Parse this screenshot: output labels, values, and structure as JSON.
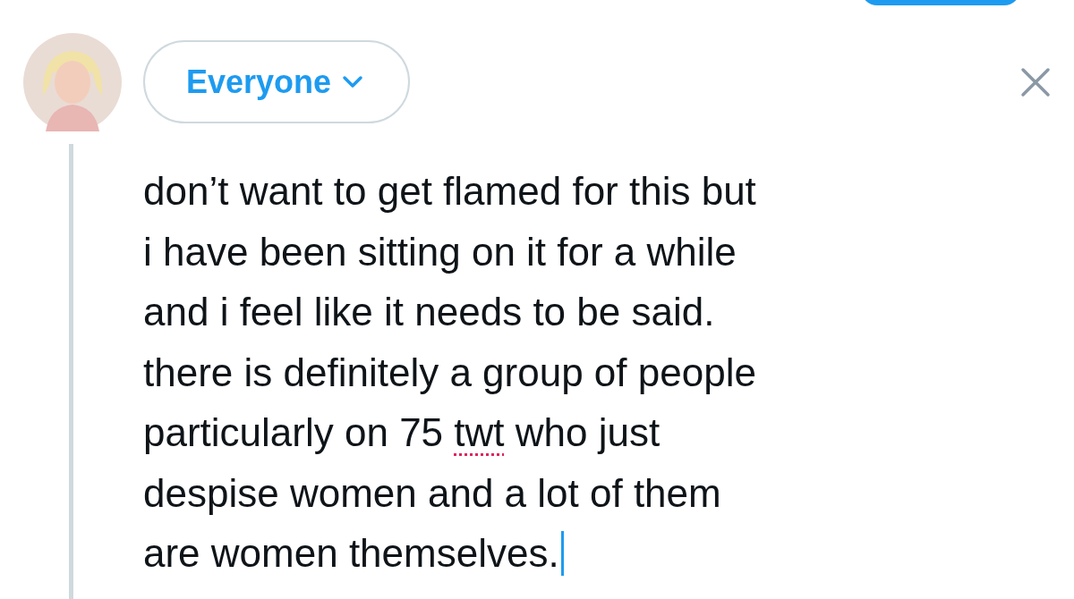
{
  "audience": {
    "label": "Everyone"
  },
  "composer": {
    "lines": [
      [
        {
          "text": "don’t want to get flamed for this but",
          "misspelled": false
        }
      ],
      [
        {
          "text": "i have been sitting on it for a while",
          "misspelled": false
        }
      ],
      [
        {
          "text": "and i feel like it needs to be said.",
          "misspelled": false
        }
      ],
      [
        {
          "text": "there is definitely a group of people",
          "misspelled": false
        }
      ],
      [
        {
          "text": "particularly on 75 ",
          "misspelled": false
        },
        {
          "text": "twt",
          "misspelled": true
        },
        {
          "text": " who just",
          "misspelled": false
        }
      ],
      [
        {
          "text": "despise women and a lot of them",
          "misspelled": false
        }
      ],
      [
        {
          "text": "are women themselves.",
          "misspelled": false
        }
      ]
    ],
    "cursor": true
  }
}
